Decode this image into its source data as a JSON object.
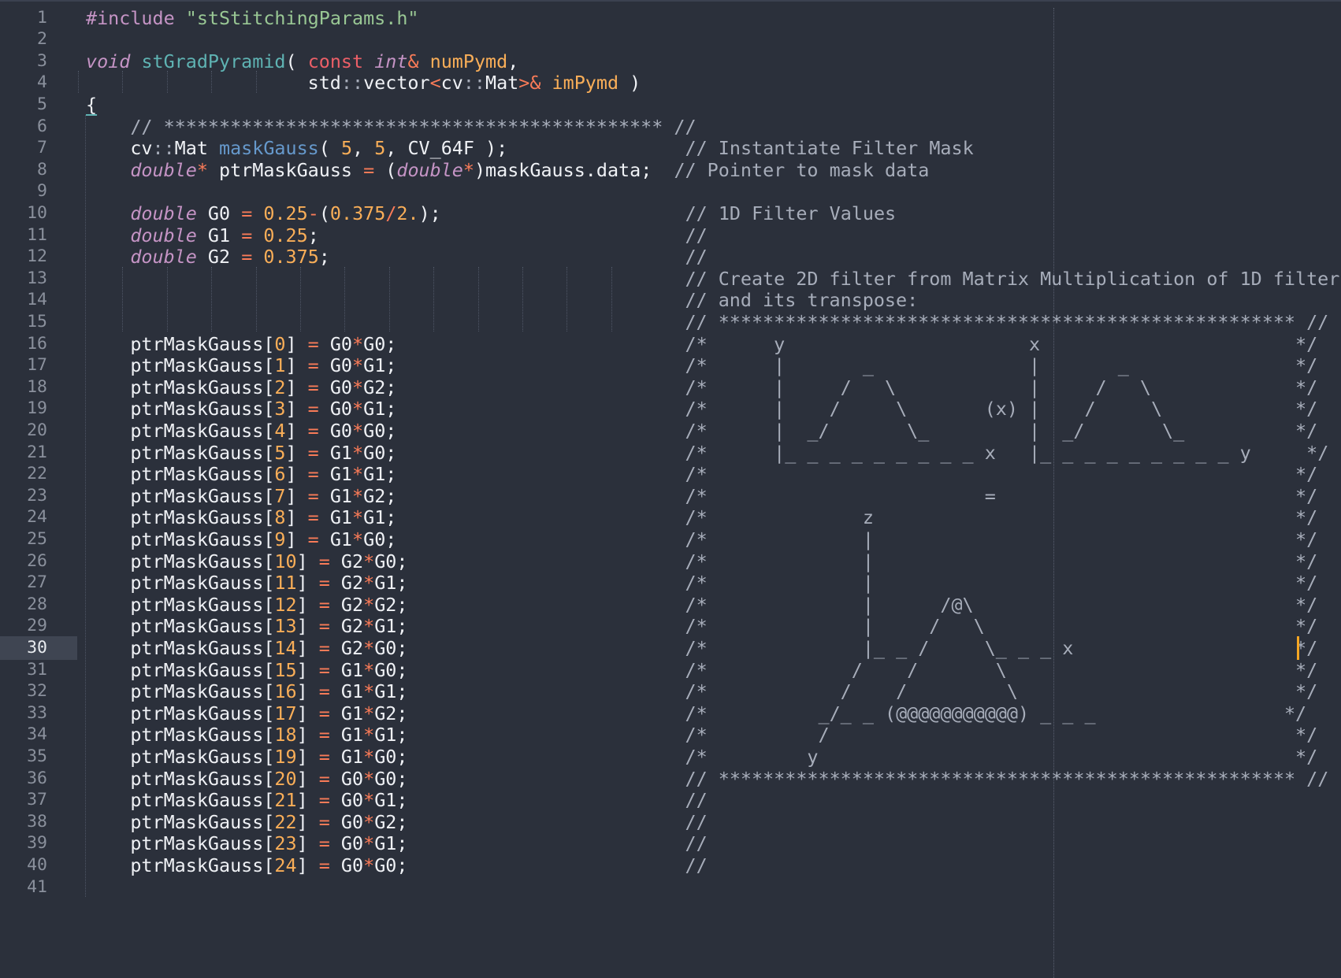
{
  "editor": {
    "active_line": 30,
    "line_numbers": [
      "1",
      "2",
      "3",
      "4",
      "5",
      "6",
      "7",
      "8",
      "9",
      "10",
      "11",
      "12",
      "13",
      "14",
      "15",
      "16",
      "17",
      "18",
      "19",
      "20",
      "21",
      "22",
      "23",
      "24",
      "25",
      "26",
      "27",
      "28",
      "29",
      "30",
      "31",
      "32",
      "33",
      "34",
      "35",
      "36",
      "37",
      "38",
      "39",
      "40",
      "41"
    ],
    "lines": [
      "#include \"stStitchingParams.h\"",
      "",
      "void stGradPyramid( const int& numPymd,",
      "                    std::vector<cv::Mat>& imPymd )",
      "{",
      "    // ********************************************* //",
      "    cv::Mat maskGauss( 5, 5, CV_64F );                // Instantiate Filter Mask",
      "    double* ptrMaskGauss = (double*)maskGauss.data;  // Pointer to mask data",
      "",
      "    double G0 = 0.25-(0.375/2.);                      // 1D Filter Values",
      "    double G1 = 0.25;                                 //",
      "    double G2 = 0.375;                                //",
      "                                                      // Create 2D filter from Matrix Multiplication of 1D filter",
      "                                                      // and its transpose:",
      "                                                      // **************************************************** //",
      "    ptrMaskGauss[0] = G0*G0;                          /*      y                      x                       */",
      "    ptrMaskGauss[1] = G0*G1;                          /*      |       _              |       _               */",
      "    ptrMaskGauss[2] = G0*G2;                          /*      |     /   \\            |     /   \\             */",
      "    ptrMaskGauss[3] = G0*G1;                          /*      |    /     \\       (x) |    /     \\            */",
      "    ptrMaskGauss[4] = G0*G0;                          /*      |  _/       \\_         |  _/       \\_          */",
      "    ptrMaskGauss[5] = G1*G0;                          /*      |_ _ _ _ _ _ _ _ _ x   |_ _ _ _ _ _ _ _ _ y     */",
      "    ptrMaskGauss[6] = G1*G1;                          /*                                                     */",
      "    ptrMaskGauss[7] = G1*G2;                          /*                         =                           */",
      "    ptrMaskGauss[8] = G1*G1;                          /*              z                                      */",
      "    ptrMaskGauss[9] = G1*G0;                          /*              |                                      */",
      "    ptrMaskGauss[10] = G2*G0;                         /*              |                                      */",
      "    ptrMaskGauss[11] = G2*G1;                         /*              |                                      */",
      "    ptrMaskGauss[12] = G2*G2;                         /*              |      /@\\                             */",
      "    ptrMaskGauss[13] = G2*G1;                         /*              |     /   \\                            */",
      "    ptrMaskGauss[14] = G2*G0;                         /*              |_ _ /     \\_ _ _ x                    */",
      "    ptrMaskGauss[15] = G1*G0;                         /*             /    /       \\                          */",
      "    ptrMaskGauss[16] = G1*G1;                         /*            /    /         \\                         */",
      "    ptrMaskGauss[17] = G1*G2;                         /*          _/_ _ (@@@@@@@@@@@) _ _ _                 */",
      "    ptrMaskGauss[18] = G1*G1;                         /*          /                                          */",
      "    ptrMaskGauss[19] = G1*G0;                         /*         y                                           */",
      "    ptrMaskGauss[20] = G0*G0;                         // **************************************************** //",
      "    ptrMaskGauss[21] = G0*G1;                         //",
      "    ptrMaskGauss[22] = G0*G2;                         //",
      "    ptrMaskGauss[23] = G0*G1;                         //",
      "    ptrMaskGauss[24] = G0*G0;                         //",
      ""
    ]
  },
  "colors": {
    "background": "#2b303b",
    "comment": "#a7adba",
    "keyword": "#c594c5",
    "number": "#f9ae58",
    "operator": "#f97b58",
    "function": "#5fb3b3",
    "string": "#99c794",
    "cursor": "#f5a623"
  }
}
